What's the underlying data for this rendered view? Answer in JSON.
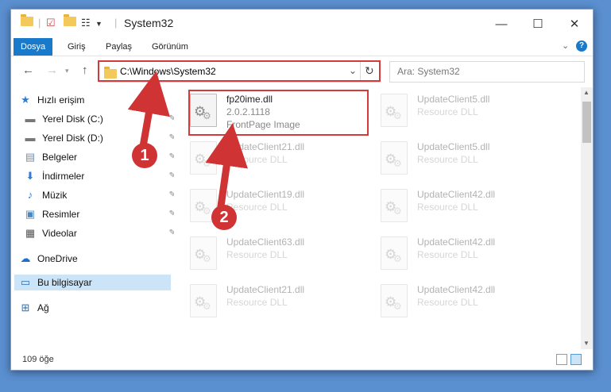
{
  "window": {
    "title": "System32"
  },
  "ribbon": {
    "tabs": [
      "Dosya",
      "Giriş",
      "Paylaş",
      "Görünüm"
    ]
  },
  "address": {
    "path": "C:\\Windows\\System32"
  },
  "search": {
    "placeholder": "Ara: System32"
  },
  "sidebar": {
    "items": [
      {
        "label": "Hızlı erişim",
        "icon": "star-icon"
      },
      {
        "label": "Yerel Disk (C:)",
        "icon": "drive-icon",
        "pinned": true
      },
      {
        "label": "Yerel Disk (D:)",
        "icon": "drive-icon",
        "pinned": true
      },
      {
        "label": "Belgeler",
        "icon": "documents-icon",
        "pinned": true
      },
      {
        "label": "İndirmeler",
        "icon": "download-icon",
        "pinned": true
      },
      {
        "label": "Müzik",
        "icon": "music-icon",
        "pinned": true
      },
      {
        "label": "Resimler",
        "icon": "pictures-icon",
        "pinned": true
      },
      {
        "label": "Videolar",
        "icon": "videos-icon",
        "pinned": true
      },
      {
        "label": "OneDrive",
        "icon": "cloud-icon"
      },
      {
        "label": "Bu bilgisayar",
        "icon": "computer-icon",
        "selected": true
      },
      {
        "label": "Ağ",
        "icon": "network-icon"
      }
    ]
  },
  "files": [
    {
      "name": "fp20ime.dll",
      "version": "2.0.2.1118",
      "type": "FrontPage Image"
    },
    {
      "name": "UpdateClient5.dll",
      "type": "Resource DLL"
    },
    {
      "name": "UpdateClient21.dll",
      "type": "Resource DLL"
    },
    {
      "name": "UpdateClient5.dll",
      "type": "Resource DLL"
    },
    {
      "name": "UpdateClient19.dll",
      "type": "Resource DLL"
    },
    {
      "name": "UpdateClient42.dll",
      "type": "Resource DLL"
    },
    {
      "name": "UpdateClient63.dll",
      "type": "Resource DLL"
    },
    {
      "name": "UpdateClient42.dll",
      "type": "Resource DLL"
    },
    {
      "name": "UpdateClient21.dll",
      "type": "Resource DLL"
    },
    {
      "name": "UpdateClient42.dll",
      "type": "Resource DLL"
    }
  ],
  "status": {
    "count": "109 öğe"
  },
  "callouts": [
    "1",
    "2"
  ],
  "colors": {
    "accent": "#1979ca",
    "highlight": "#d43a3a",
    "selection": "#cce4f7",
    "desktop": "#5a8fd0"
  }
}
